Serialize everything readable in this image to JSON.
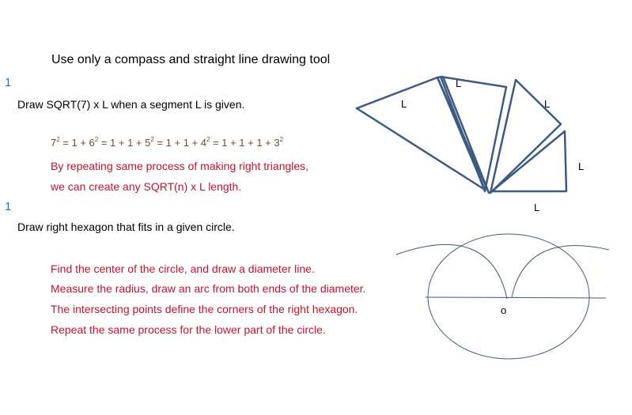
{
  "title": "Use only a compass and straight line drawing tool",
  "problems": [
    {
      "number": "1",
      "question": "Draw SQRT(7) x L when a segment L is given.",
      "equation": {
        "parts": [
          "7",
          "2",
          " = 1 + 6",
          "2",
          " = 1 + 1 + 5",
          "2",
          " = 1 + 1 + 4",
          "2",
          " = 1 + 1 + 1 + 3",
          "2"
        ]
      },
      "notes": [
        "By repeating same process of making right triangles,",
        "we can create any SQRT(n) x L length."
      ]
    },
    {
      "number": "1",
      "question": "Draw right hexagon that fits in a given circle.",
      "notes": [
        "Find the center of the circle, and draw a diameter line.",
        "Measure the radius, draw an arc from both ends of the diameter.",
        "The intersecting points define the corners of the right hexagon.",
        "Repeat the same process for the lower part of the circle."
      ]
    }
  ],
  "triangle_diagram": {
    "segment_label": "L",
    "labels": [
      "L",
      "L",
      "L",
      "L",
      "L"
    ],
    "line_color": "#3d5a80"
  },
  "circle_diagram": {
    "center_label": "o",
    "line_color": "#3d5a80"
  }
}
